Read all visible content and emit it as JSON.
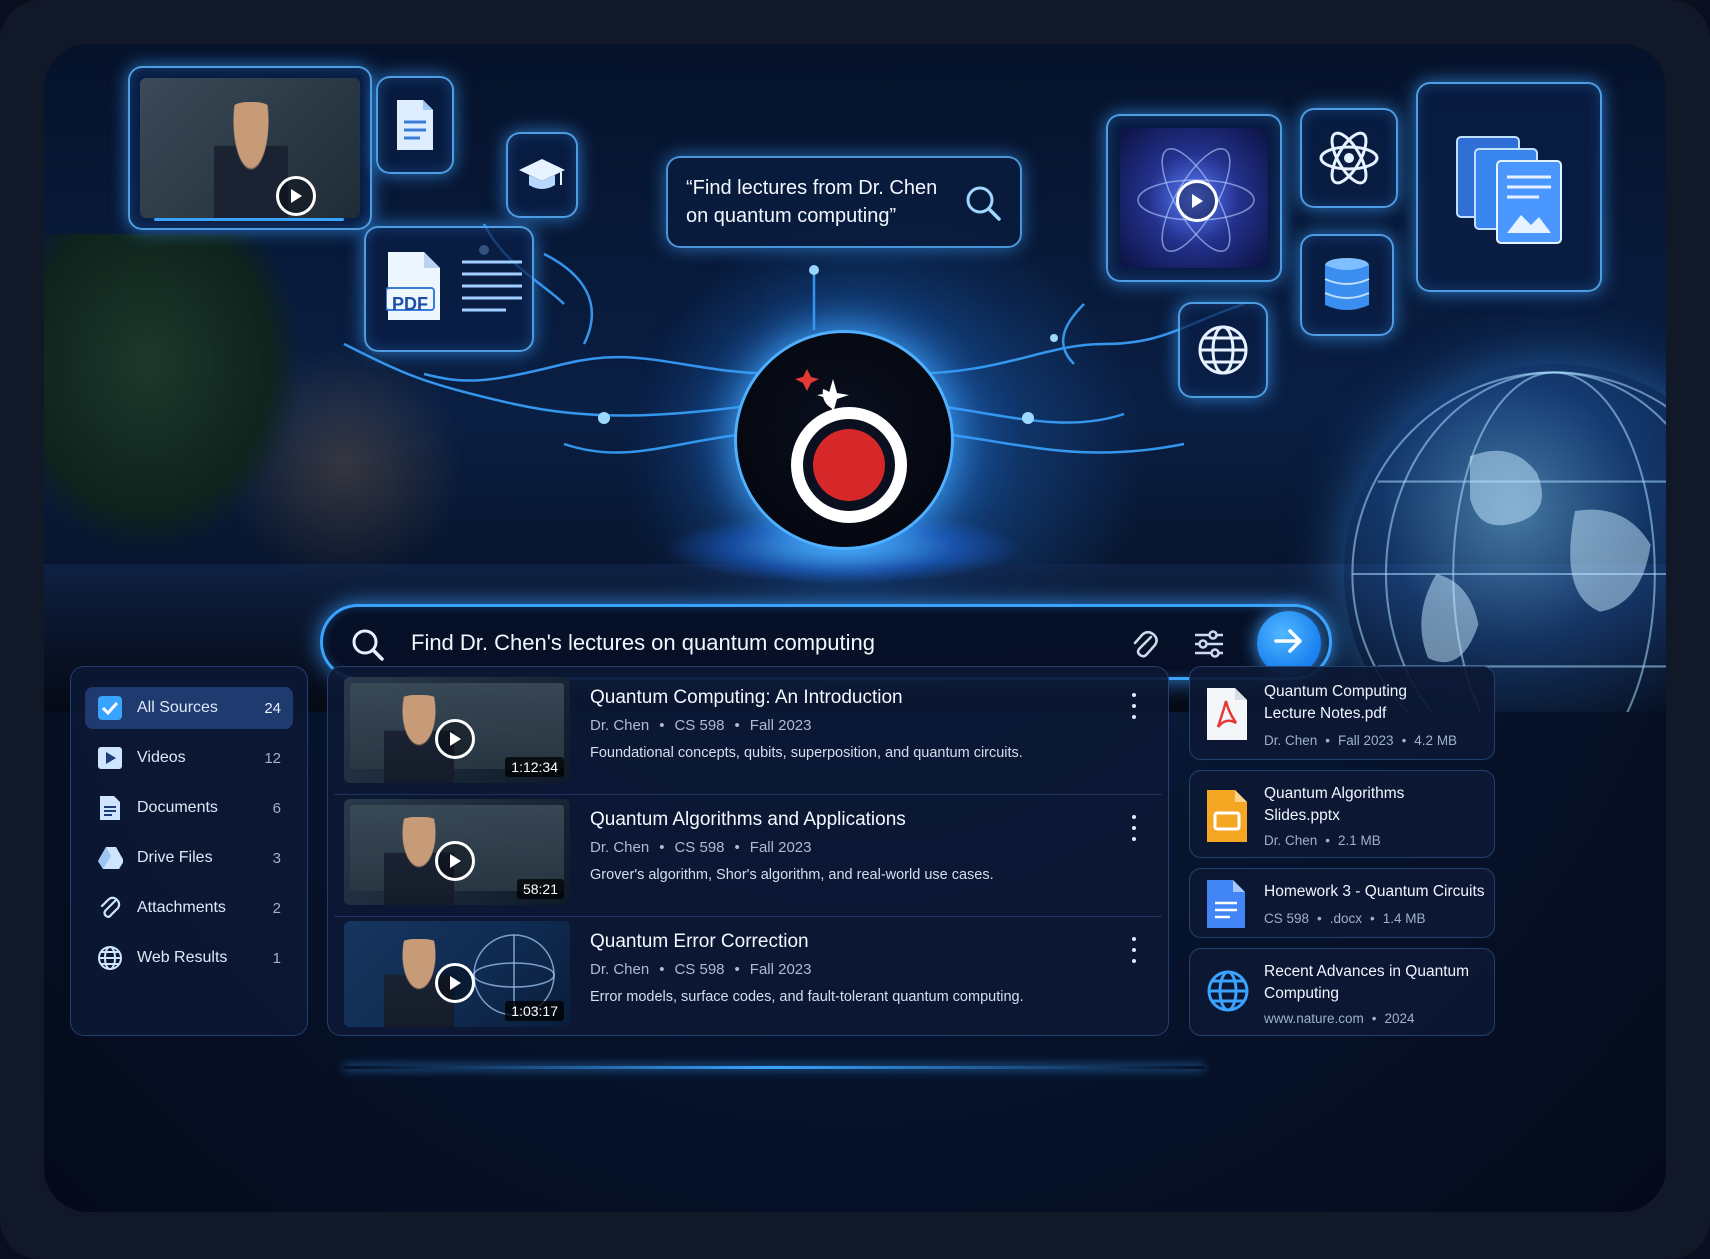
{
  "hero": {
    "query_bubble": "“Find lectures from Dr. Chen on quantum computing”",
    "pdf_label": "PDF"
  },
  "search": {
    "value": "Find Dr. Chen's lectures on quantum computing"
  },
  "sidebar": {
    "items": [
      {
        "label": "All Sources",
        "count": "24",
        "icon": "check-icon"
      },
      {
        "label": "Videos",
        "count": "12",
        "icon": "play-icon"
      },
      {
        "label": "Documents",
        "count": "6",
        "icon": "document-icon"
      },
      {
        "label": "Drive Files",
        "count": "3",
        "icon": "drive-icon"
      },
      {
        "label": "Attachments",
        "count": "2",
        "icon": "paperclip-icon"
      },
      {
        "label": "Web Results",
        "count": "1",
        "icon": "globe-icon"
      }
    ]
  },
  "results": [
    {
      "title": "Quantum Computing: An Introduction",
      "author": "Dr. Chen",
      "course": "CS 598",
      "term": "Fall 2023",
      "description": "Foundational concepts, qubits, superposition, and quantum circuits.",
      "duration": "1:12:34"
    },
    {
      "title": "Quantum Algorithms and Applications",
      "author": "Dr. Chen",
      "course": "CS 598",
      "term": "Fall 2023",
      "description": "Grover's algorithm, Shor's algorithm, and real-world use cases.",
      "duration": "58:21"
    },
    {
      "title": "Quantum Error Correction",
      "author": "Dr. Chen",
      "course": "CS 598",
      "term": "Fall 2023",
      "description": "Error models, surface codes, and fault-tolerant quantum computing.",
      "duration": "1:03:17"
    }
  ],
  "files": [
    {
      "title_1": "Quantum Computing",
      "title_2": "Lecture Notes.pdf",
      "meta": [
        "Dr. Chen",
        "Fall 2023",
        "4.2 MB"
      ],
      "icon": "pdf-icon"
    },
    {
      "title_1": "Quantum Algorithms",
      "title_2": "Slides.pptx",
      "meta": [
        "Dr. Chen",
        "2.1 MB"
      ],
      "icon": "slides-icon"
    },
    {
      "title_1": "Homework 3 - Quantum Circuits",
      "title_2": "",
      "meta": [
        "CS 598",
        ".docx",
        "1.4 MB"
      ],
      "icon": "docs-icon"
    },
    {
      "title_1": "Recent Advances in Quantum",
      "title_2": "Computing",
      "meta": [
        "www.nature.com",
        "2024"
      ],
      "icon": "globe-icon"
    }
  ],
  "colors": {
    "accent": "#3aa3ff",
    "panel": "#0c1834",
    "pdf_red": "#e53935",
    "slides_orange": "#f5a623",
    "docs_blue": "#4285f4",
    "logo_red": "#d62828"
  }
}
